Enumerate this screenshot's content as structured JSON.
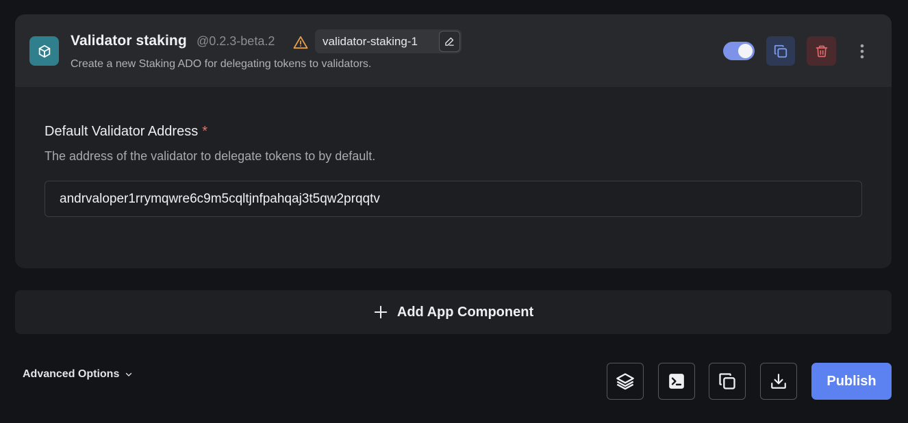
{
  "component": {
    "title": "Validator staking",
    "version": "@0.2.3-beta.2",
    "instance_name": "validator-staking-1",
    "description": "Create a new Staking ADO for delegating tokens to validators.",
    "enabled": true,
    "icons": {
      "ado": "cube-icon",
      "warning": "warning-icon",
      "edit": "pencil-icon",
      "duplicate": "copy-icon",
      "delete": "trash-icon",
      "more": "more-vertical-icon"
    }
  },
  "field": {
    "label": "Default Validator Address",
    "required_marker": "*",
    "help": "The address of the validator to delegate tokens to by default.",
    "value": "andrvaloper1rrymqwre6c9m5cqltjnfpahqaj3t5qw2prqqtv"
  },
  "add_component": {
    "label": "Add App Component",
    "icon": "plus-icon"
  },
  "footer": {
    "advanced_options": "Advanced Options",
    "advanced_icon": "chevron-down-icon",
    "tools": [
      {
        "icon": "layers-icon"
      },
      {
        "icon": "terminal-icon"
      },
      {
        "icon": "copy-icon"
      },
      {
        "icon": "download-icon"
      }
    ],
    "publish_label": "Publish"
  },
  "colors": {
    "background": "#131418",
    "card": "#1f2024",
    "header": "#28292d",
    "accent": "#5b82f0",
    "toggle": "#7d93ea",
    "ado_icon": "#2f7f8c",
    "warning": "#e8a04a",
    "danger": "#e06a6a",
    "required": "#e8736a"
  }
}
